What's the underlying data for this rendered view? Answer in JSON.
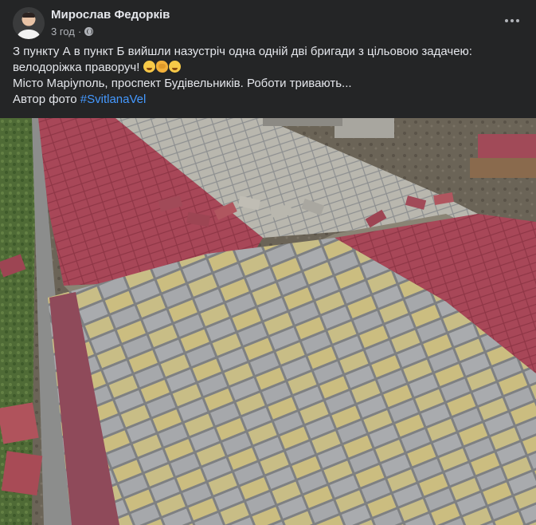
{
  "post": {
    "author": "Мирослав Федорків",
    "time": "3 год",
    "separator": "·",
    "text": {
      "line1": "З пункту А в пункт Б вийшли назустріч одна одній дві бригади з цільовою задачею:",
      "line2": "велодоріжка праворуч! ",
      "line3": "Місто Маріуполь, проспект Будівельників. Роботи тривають...",
      "line4_prefix": "Автор фото ",
      "hashtag": "#SvitlanaVel"
    },
    "emojis": [
      "flushed-face",
      "flexed-biceps",
      "rolling-on-floor-laughing"
    ],
    "photo_alt": ""
  },
  "colors": {
    "background": "#242526",
    "text": "#e4e6eb",
    "secondary_text": "#b0b3b8",
    "link": "#4599ff",
    "red_pavers": "#9a3e4e",
    "gray_pavers": "#a4a6a8",
    "yellow_pavers": "#c8b87c"
  }
}
